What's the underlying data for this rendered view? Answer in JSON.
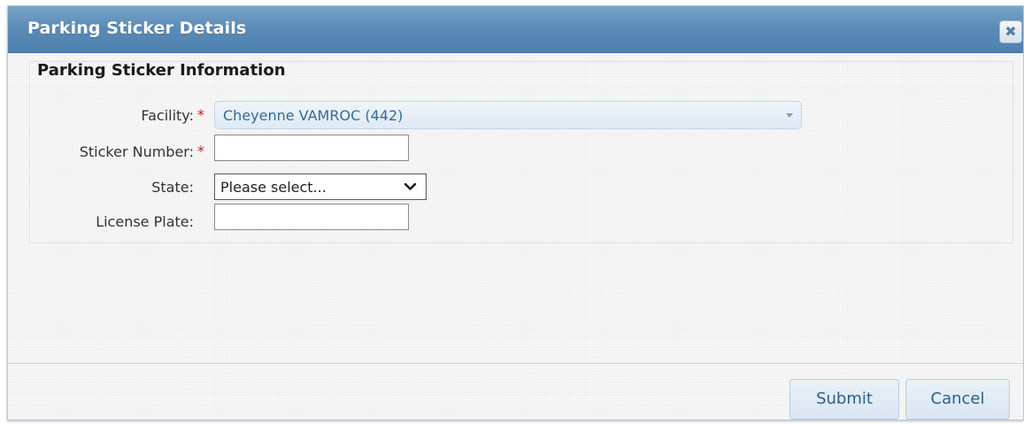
{
  "dialog": {
    "title": "Parking Sticker Details",
    "close_glyph": "✖"
  },
  "section": {
    "legend": "Parking Sticker Information"
  },
  "fields": {
    "facility": {
      "label": "Facility:",
      "required": "*",
      "value": "Cheyenne VAMROC (442)"
    },
    "sticker_number": {
      "label": "Sticker Number:",
      "required": "*",
      "value": ""
    },
    "state": {
      "label": "State:",
      "value": "Please select..."
    },
    "license_plate": {
      "label": "License Plate:",
      "value": ""
    }
  },
  "buttons": {
    "submit": "Submit",
    "cancel": "Cancel"
  },
  "colors": {
    "titlebar": "#5b8cb8",
    "required": "#cc1b1b",
    "link_text": "#356a9a"
  }
}
